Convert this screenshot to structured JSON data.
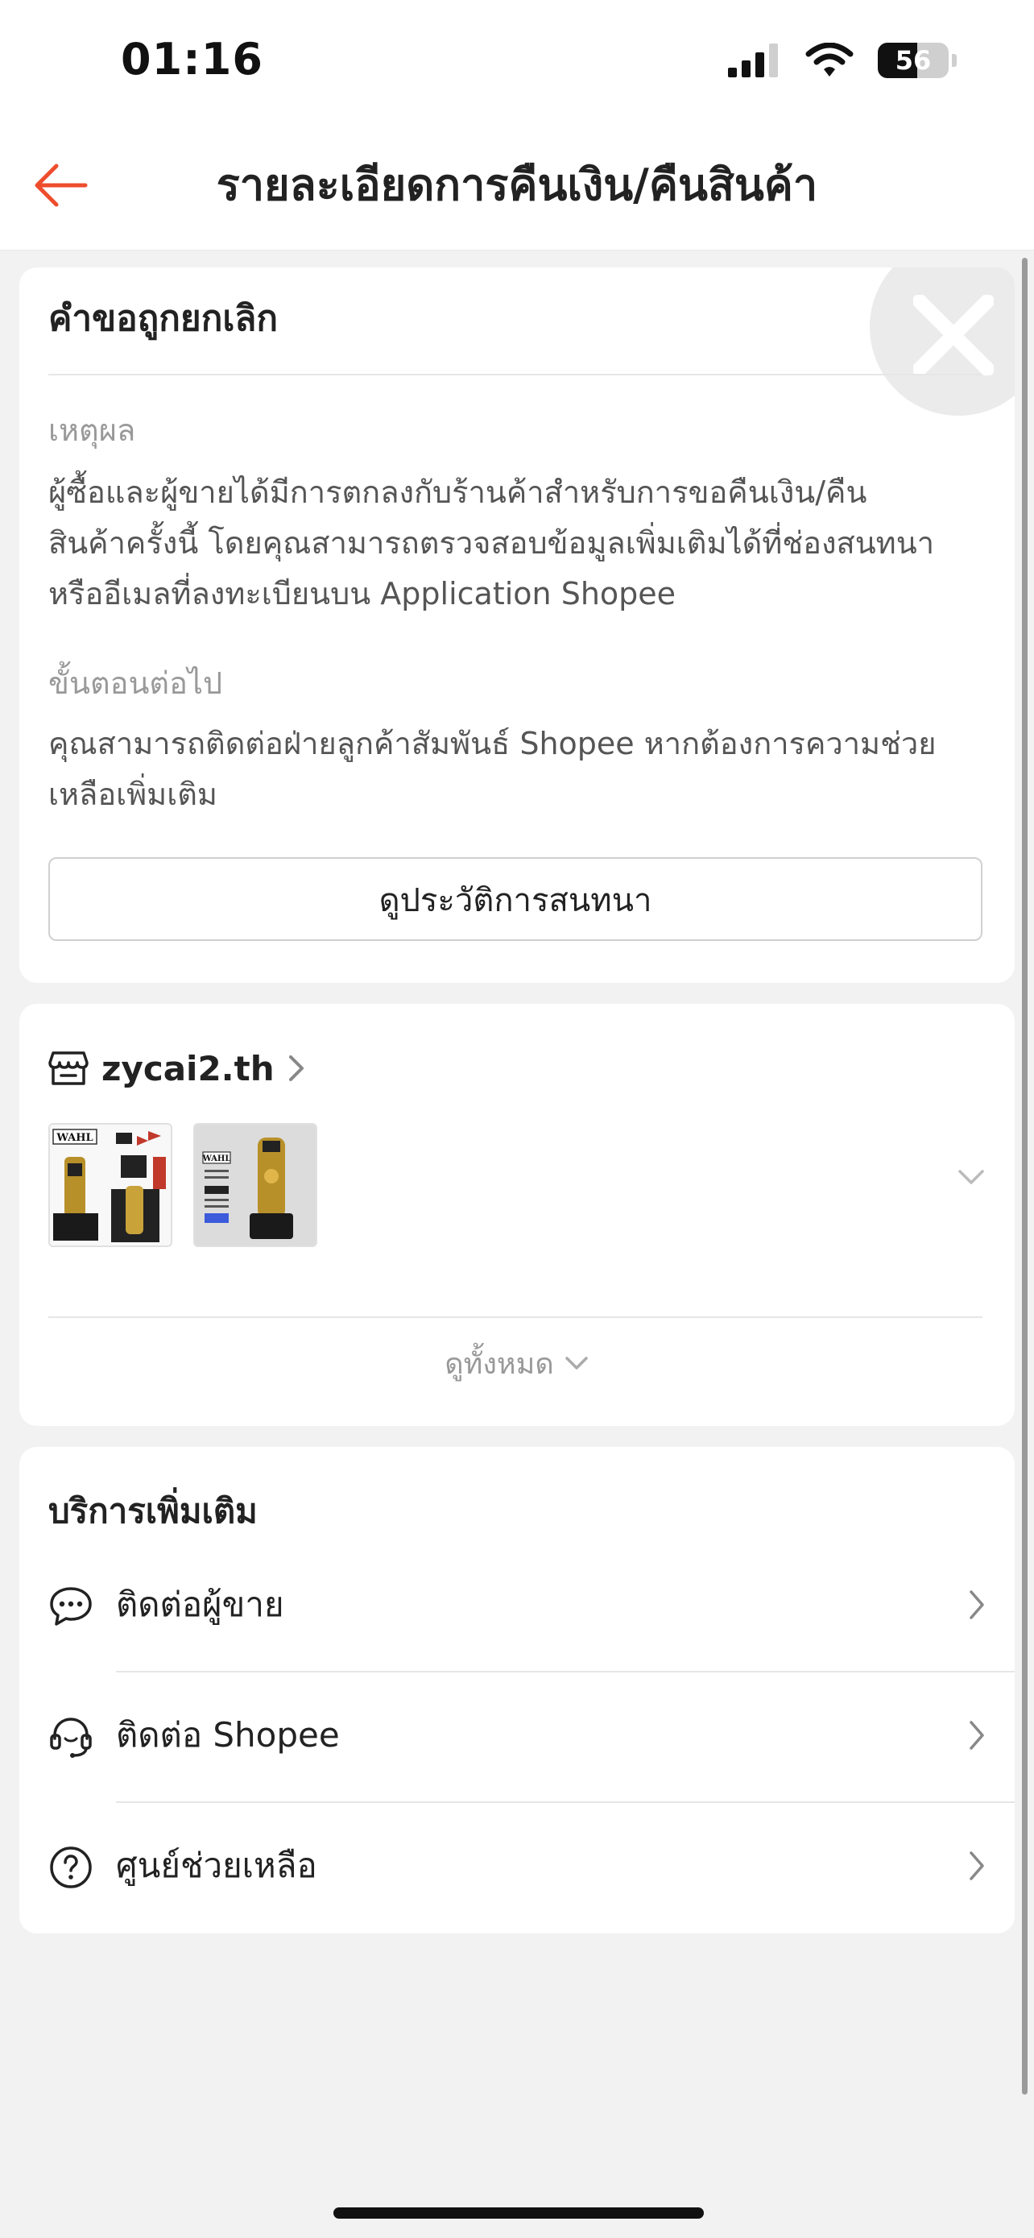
{
  "status_bar": {
    "time": "01:16",
    "battery_level": "56"
  },
  "header": {
    "title": "รายละเอียดการคืนเงิน/คืนสินค้า",
    "back_icon": "back-arrow-icon",
    "accent_color": "#ee4d2d"
  },
  "status_card": {
    "title": "คำขอถูกยกเลิก",
    "badge_icon": "close-icon",
    "reason_label": "เหตุผล",
    "reason_lines": [
      "ผู้ซื้อและผู้ขายได้มีการตกลงกับร้านค้าสำหรับการขอคืนเงิน/คืน",
      "สินค้าครั้งนี้ โดยคุณสามารถตรวจสอบข้อมูลเพิ่มเติมได้ที่ช่องสนทนา",
      "หรืออีเมลที่ลงทะเบียนบน Application Shopee"
    ],
    "next_step_label": "ขั้นตอนต่อไป",
    "next_step_lines": [
      "คุณสามารถติดต่อฝ่ายลูกค้าสัมพันธ์ Shopee หากต้องการความช่วย",
      "เหลือเพิ่มเติม"
    ],
    "chat_history_button": "ดูประวัติการสนทนา"
  },
  "shop_card": {
    "shop_name": "zycai2.th",
    "product_1_text": "WAHL",
    "product_2_text": "WAHL",
    "see_all_label": "ดูทั้งหมด"
  },
  "services": {
    "title": "บริการเพิ่มเติม",
    "items": [
      {
        "label": "ติดต่อผู้ขาย",
        "icon": "chat-bubble-icon"
      },
      {
        "label": "ติดต่อ Shopee",
        "icon": "headset-icon"
      },
      {
        "label": "ศูนย์ช่วยเหลือ",
        "icon": "help-circle-icon"
      }
    ]
  }
}
